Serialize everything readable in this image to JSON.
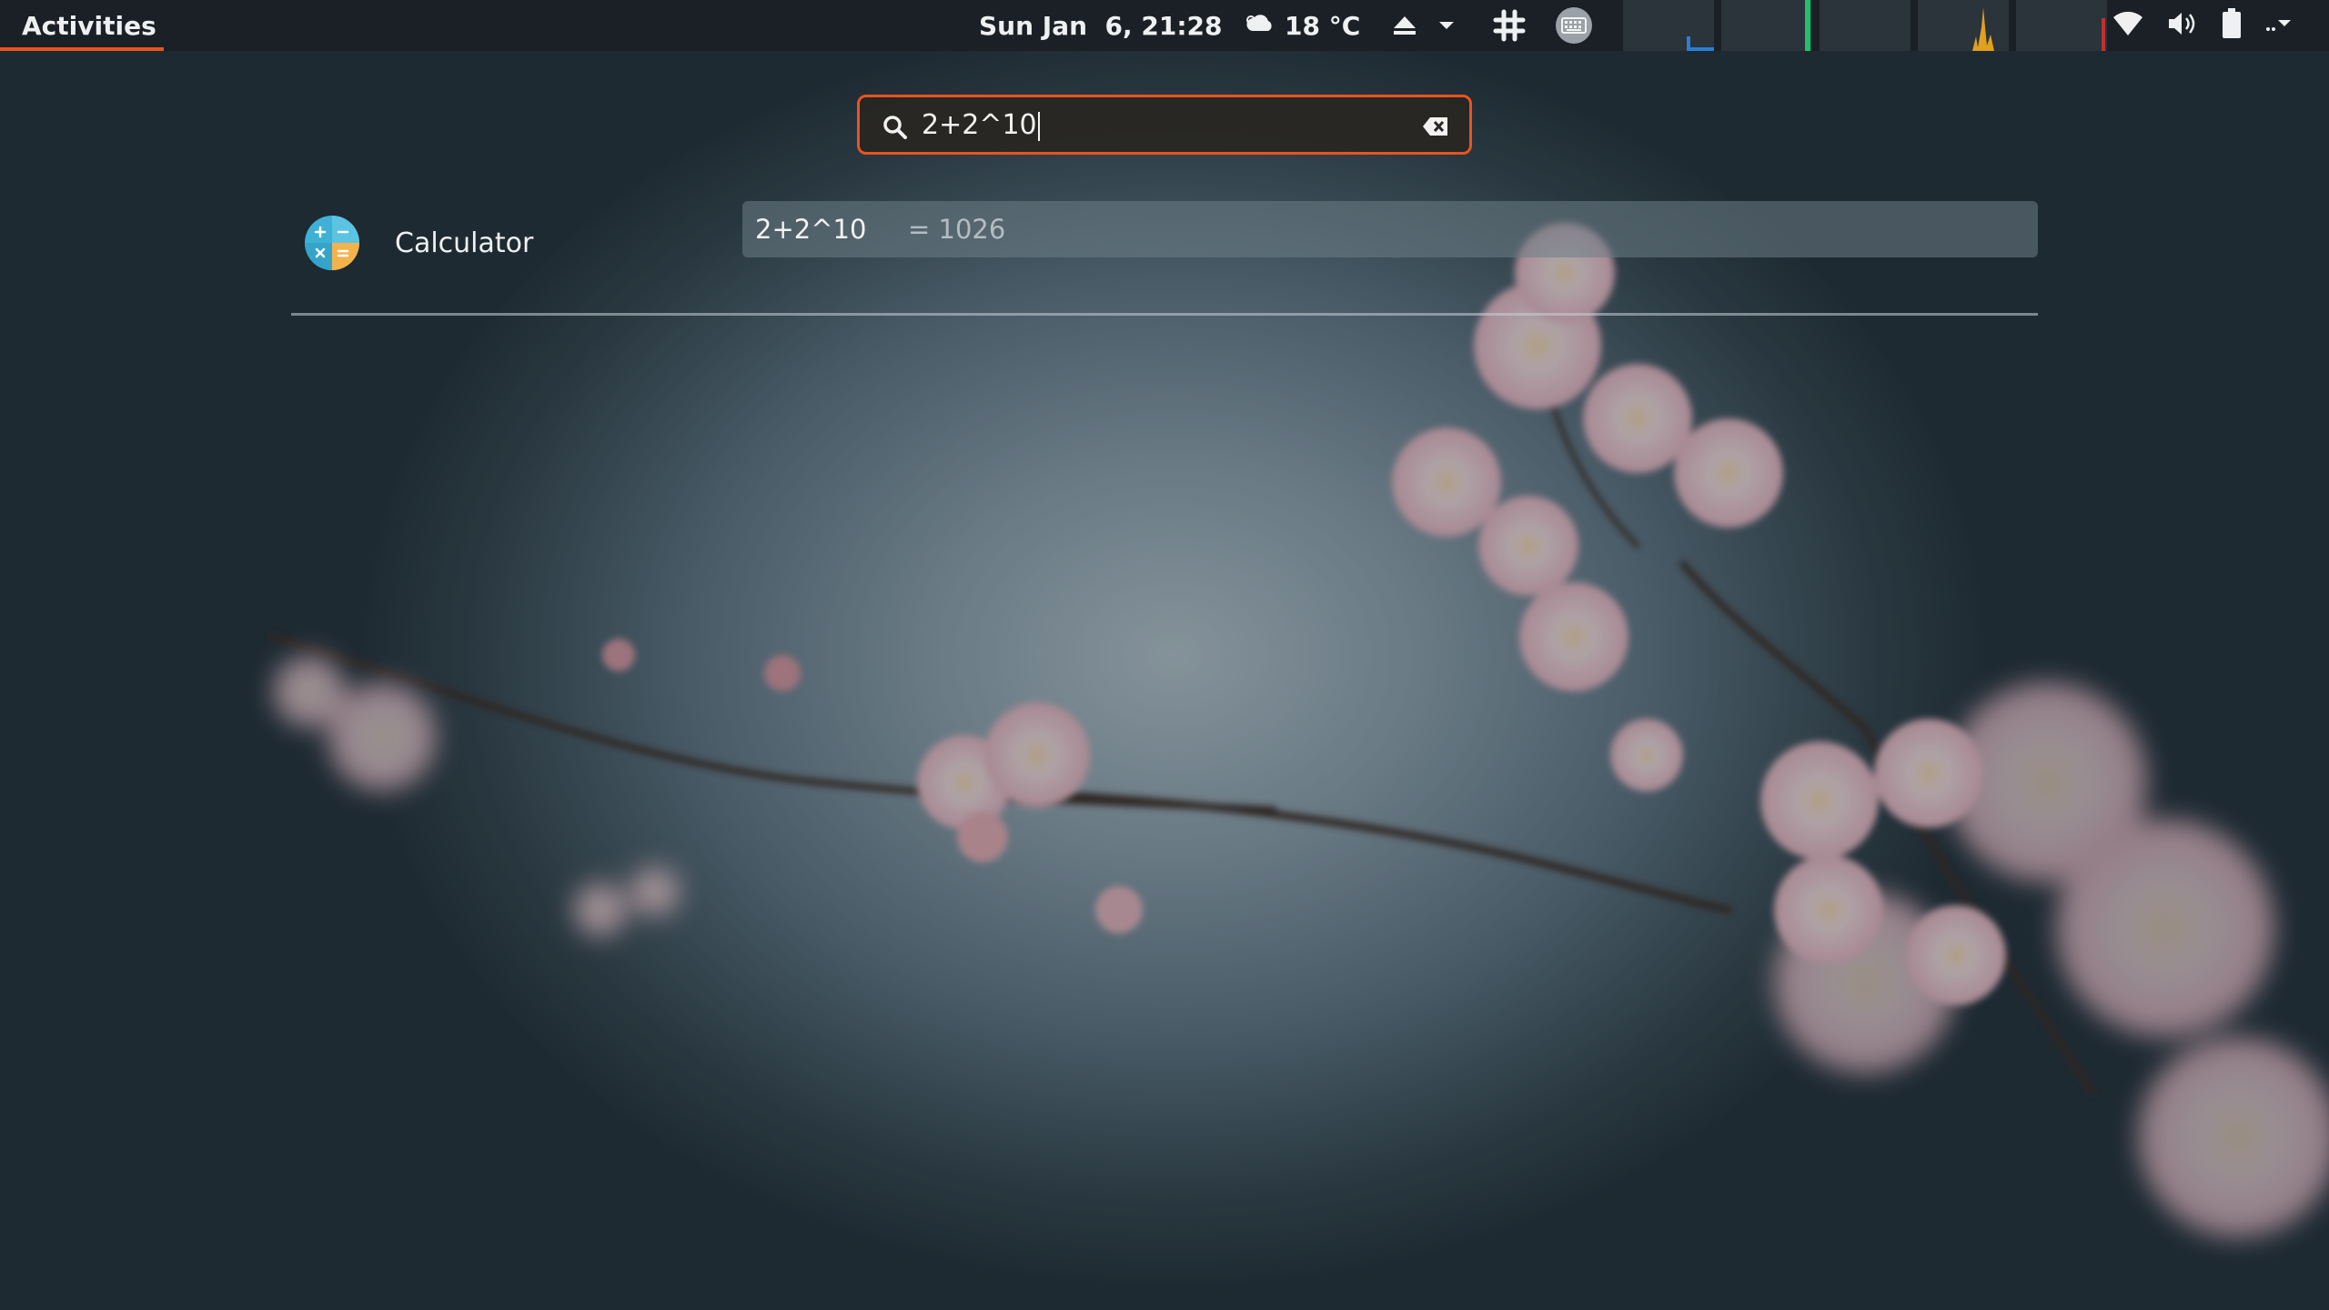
{
  "topbar": {
    "activities_label": "Activities",
    "clock": "Sun Jan  6, 21:28",
    "weather": {
      "icon": "cloudy-icon",
      "temperature": "18 °C"
    },
    "indicators": [
      "eject-icon",
      "chevron-down-icon",
      "slack-icon",
      "keyboard-icon"
    ],
    "system": [
      "wifi-icon",
      "volume-icon",
      "battery-icon",
      "chevron-down-icon"
    ]
  },
  "search": {
    "query": "2+2^10",
    "icon": "search-icon",
    "clear_icon": "clear-icon"
  },
  "results": {
    "app": {
      "label": "Calculator",
      "icon": "calculator-icon"
    },
    "calculation": {
      "expression": "2+2^10",
      "answer": "= 1026"
    }
  },
  "colors": {
    "accent": "#e95420",
    "topbar": "#1b2026",
    "monitor_cpu": "#2a7fd4",
    "monitor_net": "#22c06a",
    "monitor_disk": "#e0a020",
    "monitor_mem": "#c03030"
  }
}
